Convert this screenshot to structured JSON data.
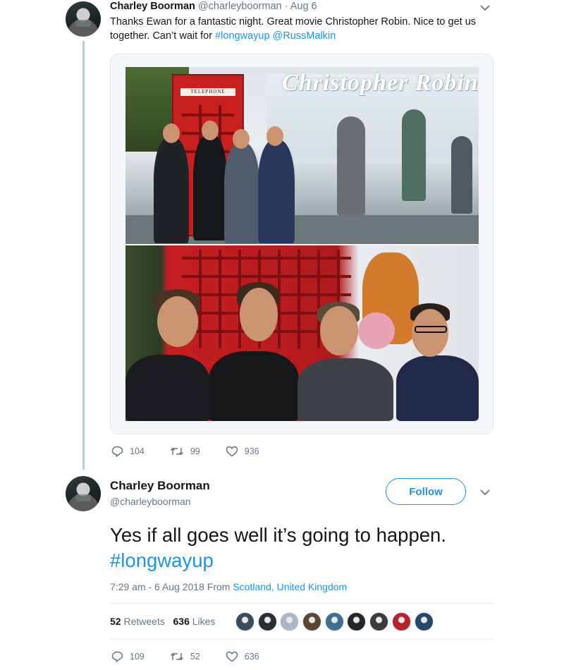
{
  "tweet1": {
    "name": "Charley Boorman",
    "handle": "@charleyboorman",
    "dot": "·",
    "date": "Aug 6",
    "text_plain": "Thanks Ewan for a fantastic night. Great movie Christopher Robin.  Nice to get us together.  Can’t wait for ",
    "hashtag": "#longwayup",
    "mention": "@RussMalkin",
    "photo": {
      "booth_sign": "TELEPHONE",
      "banner_text": "Christopher Robin"
    },
    "actions": {
      "replies": "104",
      "retweets": "99",
      "likes": "936"
    }
  },
  "tweet2": {
    "name": "Charley Boorman",
    "handle": "@charleyboorman",
    "follow_label": "Follow",
    "text_plain": "Yes if all goes well it’s going to happen.",
    "hashtag": "#longwayup",
    "time": "7:29 am - 6 Aug 2018",
    "from_label": "From",
    "location": "Scotland, United Kingdom",
    "retweets_count": "52",
    "retweets_label": "Retweets",
    "likes_count": "636",
    "likes_label": "Likes",
    "likers": [
      "#3a4b5c",
      "#2b2f33",
      "#a9b7c4",
      "#5c4630",
      "#3d6d8f",
      "#24272a",
      "#3b3b3b",
      "#b8222a",
      "#26496b"
    ],
    "actions": {
      "replies": "109",
      "retweets": "52",
      "likes": "636"
    }
  },
  "colors": {
    "link": "#1b95e0",
    "muted": "#657786",
    "thread_line": "#a9cfe6"
  }
}
